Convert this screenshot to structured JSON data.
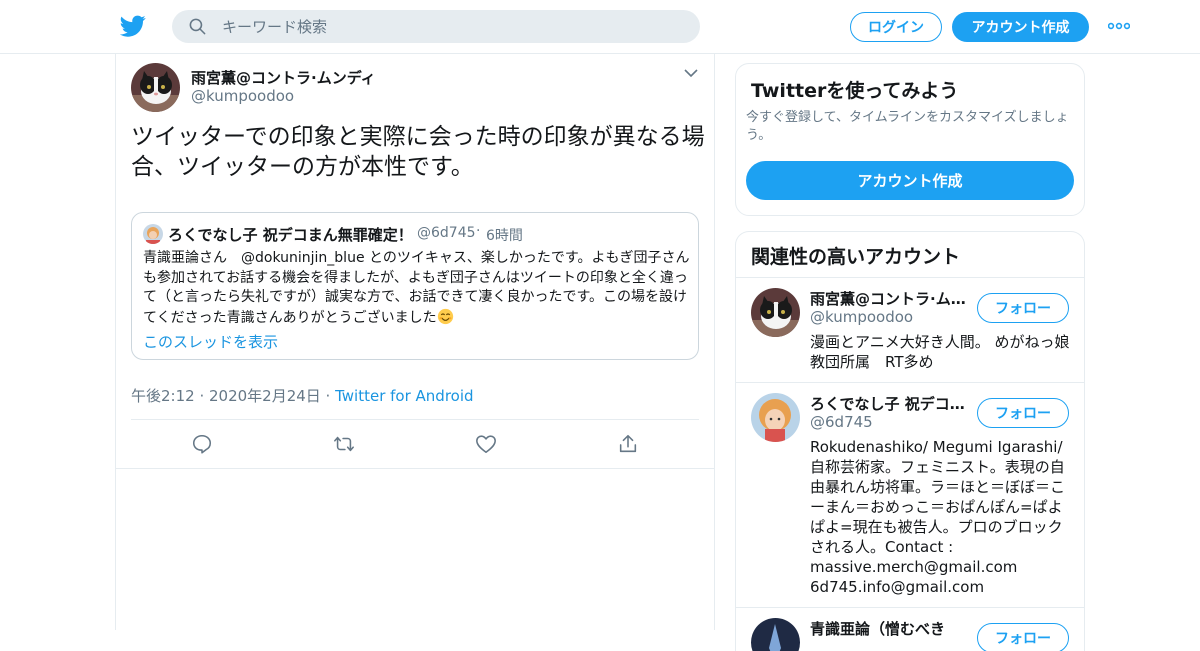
{
  "header": {
    "search_placeholder": "キーワード検索",
    "login_label": "ログイン",
    "signup_label": "アカウント作成",
    "icons": [
      "twitter-bird-icon",
      "search-icon",
      "more-icon"
    ]
  },
  "tweet": {
    "author_name": "雨宮薫@コントラ·ムンディ",
    "author_handle": "@kumpoodoo",
    "text": "ツイッターでの印象と実際に会った時の印象が異なる場合、ツイッターの方が本性です。",
    "quoted": {
      "name": "ろくでなし子 祝デコまん無罪確定！",
      "handle": "@6d745",
      "separator": "·",
      "time": "6時間",
      "text": "青識亜論さん　@dokuninjin_blue とのツイキャス、楽しかったです。よもぎ団子さんも参加されてお話する機会を得ましたが、よもぎ団子さんはツイートの印象と全く違って（と言ったら失礼ですが）誠実な方で、お話できて凄く良かったです。この場を設けてくださった青識さんありがとうございました",
      "show_thread": "このスレッドを表示"
    },
    "timestamp": "午後2:12 · 2020年2月24日 · ",
    "via": "Twitter for Android",
    "action_icons": [
      "reply-icon",
      "retweet-icon",
      "like-icon",
      "share-icon"
    ]
  },
  "signup_card": {
    "title": "Twitterを使ってみよう",
    "subtitle": "今すぐ登録して、タイムラインをカスタマイズしましょう。",
    "button": "アカウント作成"
  },
  "related": {
    "title": "関連性の高いアカウント",
    "follow_label": "フォロー",
    "accounts": [
      {
        "name": "雨宮薫@コントラ·ムンディ",
        "handle": "@kumpoodoo",
        "bio": "漫画とアニメ大好き人間。 めがねっ娘教団所属　RT多め"
      },
      {
        "name": "ろくでなし子 祝デコまん無罪確定！",
        "handle": "@6d745",
        "bio": "Rokudenashiko/ Megumi Igarashi/ 自称芸術家。フェミニスト。表現の自由暴れん坊将軍。ラ＝ほと＝ぼぼ＝こーまん＝おめっこ＝おぱんぽん=ぱよぱよ=現在も被告人。プロのブロックされる人。Contact :\nmassive.merch@gmail.com\n6d745.info@gmail.com"
      },
      {
        "name": "青識亜論（憎むべき",
        "handle": "",
        "bio": ""
      }
    ]
  },
  "colors": {
    "accent": "#1da1f2",
    "link": "#1b95e0",
    "secondary_text": "#657786",
    "border": "#e6ecf0"
  }
}
